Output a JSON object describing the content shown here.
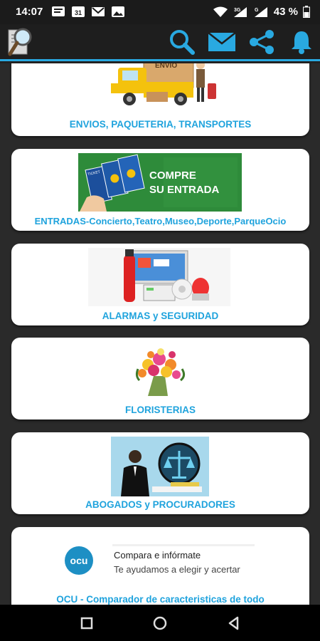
{
  "status": {
    "time": "14:07",
    "left_icons": [
      "sms-icon",
      "calendar-icon",
      "gmail-icon",
      "image-icon"
    ],
    "calendar_day": "31",
    "network_badge": "3G",
    "network_badge2": "G",
    "battery": "43 %"
  },
  "app_bar": {
    "logo": "magnifier-logo",
    "actions": [
      "search-icon",
      "mail-icon",
      "share-icon",
      "bell-icon"
    ]
  },
  "cards": [
    {
      "label": "ENVIOS, PAQUETERIA, TRANSPORTES",
      "image": "delivery-truck",
      "truck_text": "ENVIO"
    },
    {
      "label": "ENTRADAS-Concierto,Teatro,Museo,Deporte,ParqueOcio",
      "image": "tickets-banner",
      "banner_line1": "COMPRE",
      "banner_line2": "SU ENTRADA",
      "ticket_text": "TICKET"
    },
    {
      "label": "ALARMAS y SEGURIDAD",
      "image": "alarm-equipment"
    },
    {
      "label": "FLORISTERIAS",
      "image": "flower-bouquet"
    },
    {
      "label": "ABOGADOS y PROCURADORES",
      "image": "lawyer-scales"
    },
    {
      "label": "OCU - Comparador de caracteristicas de todo",
      "image": "ocu-ad",
      "ad_title": "Compara e infórmate",
      "ad_subtitle": "Te ayudamos a elegir y acertar",
      "ad_logo": "ocu"
    }
  ],
  "colors": {
    "accent": "#29a9e1",
    "label": "#1fa3dd",
    "banner_green": "#2e8b3a"
  },
  "nav": [
    "recents-button",
    "home-button",
    "back-button"
  ]
}
